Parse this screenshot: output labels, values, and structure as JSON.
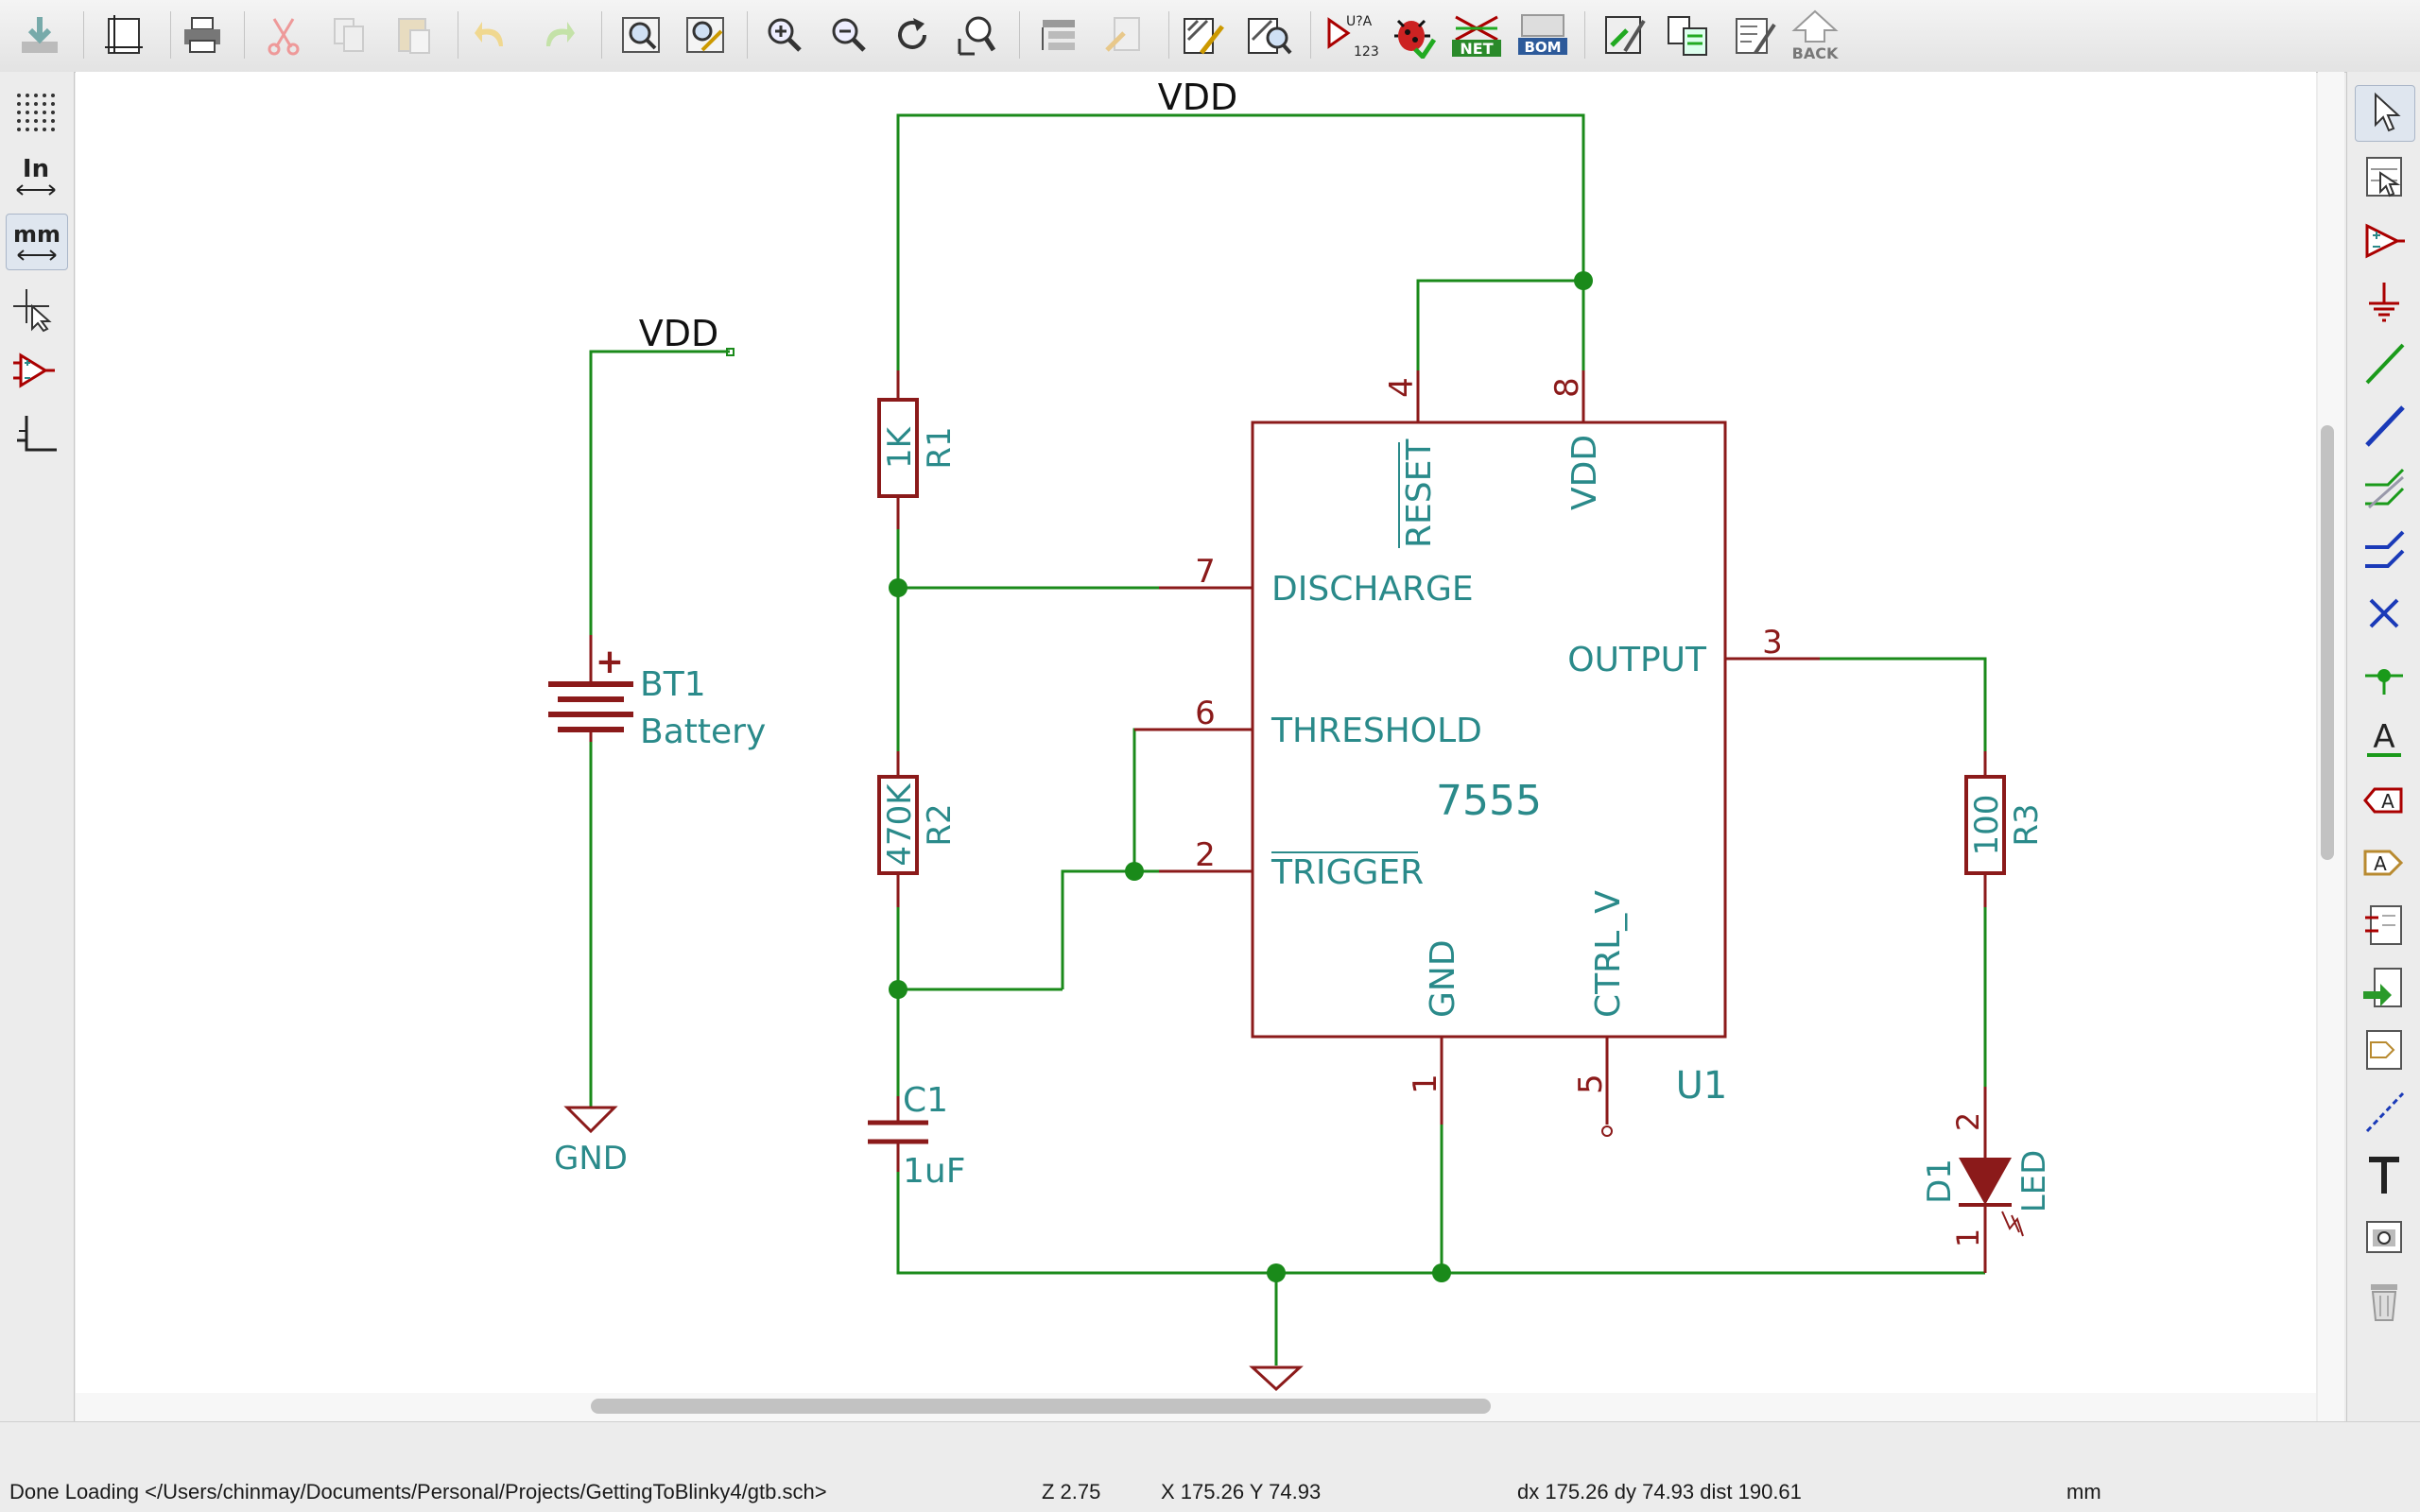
{
  "toolbar": {
    "icons": [
      "load-schematic",
      "page-settings",
      "print",
      "cut",
      "copy",
      "paste",
      "undo",
      "redo",
      "find",
      "find-replace",
      "zoom-in",
      "zoom-out",
      "redraw",
      "zoom-fit",
      "hierarchy-navigator",
      "leave-sheet",
      "symbol-editor",
      "symbol-browser",
      "annotate",
      "erc",
      "netlist",
      "bom",
      "assign-footprints",
      "pcb",
      "edit-pcb",
      "back"
    ],
    "annotate_label_top": "U?A",
    "annotate_label_bottom": "123",
    "netlist_label": "NET",
    "bom_label": "BOM",
    "back_label": "BACK"
  },
  "left_toolbar": {
    "grid_tooltip": "Show grid",
    "inches_label": "In",
    "mm_label": "mm",
    "active_unit": "mm"
  },
  "right_toolbar": {
    "tools": [
      "select",
      "hierarchy-pins",
      "add-symbol",
      "add-power",
      "add-wire",
      "add-bus",
      "wire-bus-entry",
      "bus-bus-entry",
      "no-connect",
      "junction",
      "net-label",
      "global-label",
      "hierarchical-label",
      "hierarchical-sheet",
      "import-sheet-pin",
      "sheet-pin",
      "graphic-line",
      "text",
      "image",
      "delete"
    ],
    "text_tool_label": "A"
  },
  "schematic": {
    "u1": {
      "ref": "U1",
      "value": "7555",
      "pins": {
        "discharge": "DISCHARGE",
        "threshold": "THRESHOLD",
        "trigger": "TRIGGER",
        "reset": "RESET",
        "vdd": "VDD",
        "output": "OUTPUT",
        "gnd": "GND",
        "ctrl": "CTRL_V"
      },
      "pin_numbers": {
        "discharge": "7",
        "threshold": "6",
        "trigger": "2",
        "reset": "4",
        "vdd": "8",
        "output": "3",
        "gnd": "1",
        "ctrl": "5"
      }
    },
    "r1": {
      "ref": "R1",
      "value": "1K"
    },
    "r2": {
      "ref": "R2",
      "value": "470K"
    },
    "r3": {
      "ref": "R3",
      "value": "100"
    },
    "c1": {
      "ref": "C1",
      "value": "1uF"
    },
    "bt1": {
      "ref": "BT1",
      "value": "Battery",
      "plus": "+"
    },
    "d1": {
      "ref": "D1",
      "value": "LED",
      "pin_a": "2",
      "pin_k": "1"
    },
    "net_labels": {
      "vdd_top": "VDD",
      "vdd_left": "VDD",
      "gnd_left": "GND"
    }
  },
  "status": {
    "message": "Done Loading </Users/chinmay/Documents/Personal/Projects/GettingToBlinky4/gtb.sch>",
    "zoom": "Z 2.75",
    "coords": "X 175.26  Y 74.93",
    "delta": "dx 175.26  dy 74.93  dist 190.61",
    "units": "mm"
  },
  "colors": {
    "wire": "#1a8a1a",
    "component": "#8b1a1a",
    "text": "#2a8a8a",
    "junction": "#1a8a1a"
  }
}
